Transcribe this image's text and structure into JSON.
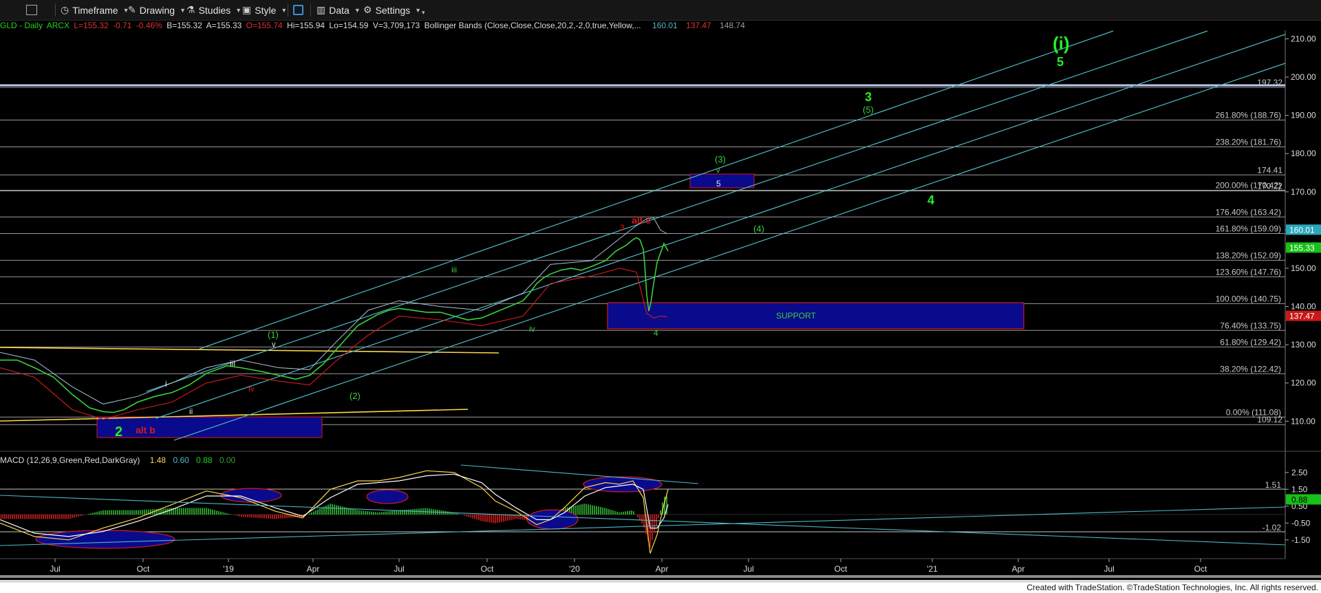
{
  "toolbar": {
    "timeframe": "Timeframe",
    "drawing": "Drawing",
    "studies": "Studies",
    "style": "Style",
    "data": "Data",
    "settings": "Settings"
  },
  "status": {
    "symbol": "GLD - Daily",
    "exchange": "ARCX",
    "last": "L=155.32",
    "change": "-0.71",
    "change_pct": "-0.46%",
    "bid": "B=155.32",
    "ask": "A=155.33",
    "open": "O=155.74",
    "high": "Hi=155.94",
    "low": "Lo=154.59",
    "volume": "V=3,709,173",
    "study": "Bollinger Bands (Close,Close,Close,20,2,-2,0,true,Yellow,...",
    "bb_upper": "160.01",
    "bb_lower": "137.47",
    "bb_mid": "148.74"
  },
  "macd_header": {
    "name": "MACD (12,26,9,Green,Red,DarkGray)",
    "v1": "1.48",
    "v2": "0.60",
    "v3": "0.88",
    "v4": "0.00"
  },
  "footer": "Created with TradeStation. ©TradeStation Technologies, Inc. All rights reserved.",
  "colors": {
    "green": "#3ad13a",
    "bright_green": "#22ee22",
    "red": "#d81b1b",
    "cyan": "#4fb8c9",
    "yellow": "#ffd84a",
    "blue_box": "#0a0a8c",
    "grid": "#9a9a9a"
  },
  "chart_data": [
    {
      "type": "line",
      "title": "GLD - Daily",
      "price_axis": {
        "ylim": [
          107,
          213
        ],
        "ticks": [
          110,
          120,
          130,
          140,
          150,
          160,
          170,
          180,
          190,
          200,
          210
        ]
      },
      "time_axis": {
        "labels": [
          "Jul",
          "Oct",
          "'19",
          "Apr",
          "Jul",
          "Oct",
          "'20",
          "Apr",
          "Jul",
          "Oct",
          "'21",
          "Apr",
          "Jul",
          "Oct"
        ]
      },
      "fib_levels": [
        {
          "label": "0.00% (111.08)",
          "value": 111.08
        },
        {
          "label": "38.20% (122.42)",
          "value": 122.42
        },
        {
          "label": "61.80% (129.42)",
          "value": 129.42
        },
        {
          "label": "76.40% (133.75)",
          "value": 133.75
        },
        {
          "label": "100.00% (140.75)",
          "value": 140.75
        },
        {
          "label": "123.60% (147.76)",
          "value": 147.76
        },
        {
          "label": "138.20% (152.09)",
          "value": 152.09
        },
        {
          "label": "161.80% (159.09)",
          "value": 159.09
        },
        {
          "label": "176.40% (163.42)",
          "value": 163.42
        },
        {
          "label": "200.00% (170.42)",
          "value": 170.42
        },
        {
          "label": "238.20% (181.76)",
          "value": 181.76
        },
        {
          "label": "261.80% (188.76)",
          "value": 188.76
        }
      ],
      "price_markers": [
        {
          "label": "197.32",
          "value": 197.32
        },
        {
          "label": "174.41",
          "value": 174.41
        },
        {
          "label": "170.22",
          "value": 170.22
        },
        {
          "label": "109.12",
          "value": 109.12
        }
      ],
      "axis_badges": [
        {
          "label": "160.01",
          "value": 160.01,
          "color": "#2aa6b8"
        },
        {
          "label": "155.33",
          "value": 155.33,
          "color": "#18c018"
        },
        {
          "label": "137.47",
          "value": 137.47,
          "color": "#c81818"
        }
      ],
      "boxes": [
        {
          "label": "SUPPORT",
          "x_start": "2020-02-10",
          "x_end": "2021-03-25",
          "y_low": 133.7,
          "y_high": 140.75
        },
        {
          "label": "5",
          "x_start": "2020-04-25",
          "x_end": "2020-06-10",
          "y_low": 170.6,
          "y_high": 174.3
        },
        {
          "label": "2",
          "x_start": "2018-08-01",
          "x_end": "2018-12-31",
          "y_low": 106.2,
          "y_high": 111.3
        }
      ],
      "wave_labels": [
        {
          "text": "(i)",
          "color": "bright_green"
        },
        {
          "text": "5",
          "color": "bright_green"
        },
        {
          "text": "3",
          "color": "bright_green"
        },
        {
          "text": "(5)",
          "color": "green"
        },
        {
          "text": "(3)",
          "color": "green"
        },
        {
          "text": "v",
          "color": "green"
        },
        {
          "text": "4",
          "color": "bright_green"
        },
        {
          "text": "(4)",
          "color": "green"
        },
        {
          "text": "alt c",
          "color": "red"
        },
        {
          "text": "3",
          "color": "red"
        },
        {
          "text": "iii",
          "color": "green"
        },
        {
          "text": "iv",
          "color": "green"
        },
        {
          "text": "4",
          "color": "green"
        },
        {
          "text": "(1)",
          "color": "green"
        },
        {
          "text": "v",
          "color": "white"
        },
        {
          "text": "iii",
          "color": "white"
        },
        {
          "text": "iv",
          "color": "red"
        },
        {
          "text": "i",
          "color": "white"
        },
        {
          "text": "ii",
          "color": "white"
        },
        {
          "text": "(2)",
          "color": "green"
        },
        {
          "text": "2",
          "color": "bright_green"
        },
        {
          "text": "alt b",
          "color": "red"
        }
      ],
      "series": [
        {
          "values": [
            [
              0,
              126
            ],
            [
              25,
              126
            ],
            [
              50,
              124
            ],
            [
              78,
              121.5
            ],
            [
              105,
              117
            ],
            [
              130,
              113.5
            ],
            [
              150,
              112.5
            ],
            [
              165,
              112.3
            ],
            [
              180,
              113
            ],
            [
              200,
              115
            ],
            [
              225,
              116.5
            ],
            [
              250,
              117.5
            ],
            [
              275,
              119.5
            ],
            [
              300,
              122.5
            ],
            [
              330,
              124.5
            ],
            [
              350,
              124
            ],
            [
              380,
              123
            ],
            [
              405,
              122
            ],
            [
              430,
              121
            ],
            [
              450,
              122
            ],
            [
              470,
              125
            ],
            [
              490,
              129
            ],
            [
              505,
              132
            ],
            [
              520,
              135
            ],
            [
              535,
              136.5
            ],
            [
              550,
              138
            ],
            [
              565,
              139
            ],
            [
              580,
              139.5
            ],
            [
              600,
              139
            ],
            [
              620,
              138.5
            ],
            [
              640,
              138.5
            ],
            [
              660,
              137.5
            ],
            [
              680,
              136.5
            ],
            [
              700,
              137
            ],
            [
              720,
              138.5
            ],
            [
              740,
              140
            ],
            [
              760,
              141.5
            ],
            [
              770,
              143.5
            ],
            [
              780,
              146
            ],
            [
              790,
              147.5
            ],
            [
              800,
              148.5
            ],
            [
              815,
              149.5
            ],
            [
              830,
              150
            ],
            [
              845,
              149.5
            ],
            [
              860,
              150.5
            ],
            [
              880,
              152
            ],
            [
              895,
              154.5
            ],
            [
              910,
              156
            ],
            [
              920,
              157.5
            ],
            [
              925,
              158
            ],
            [
              930,
              157.5
            ],
            [
              935,
              155
            ],
            [
              937,
              151
            ],
            [
              940,
              143
            ],
            [
              943,
              138.8
            ],
            [
              946,
              141
            ],
            [
              950,
              146
            ],
            [
              955,
              151.5
            ],
            [
              960,
              154
            ],
            [
              965,
              156.5
            ],
            [
              968,
              155.5
            ],
            [
              971,
              154.5
            ]
          ]
        },
        {
          "values": [
            [
              0,
              128
            ],
            [
              50,
              126
            ],
            [
              105,
              119
            ],
            [
              150,
              114.5
            ],
            [
              200,
              116.5
            ],
            [
              250,
              120
            ],
            [
              300,
              124
            ],
            [
              350,
              126
            ],
            [
              405,
              124
            ],
            [
              450,
              123.5
            ],
            [
              490,
              131
            ],
            [
              535,
              139
            ],
            [
              580,
              141.5
            ],
            [
              640,
              140
            ],
            [
              700,
              139
            ],
            [
              760,
              143.5
            ],
            [
              800,
              151
            ],
            [
              860,
              152
            ],
            [
              920,
              160.5
            ],
            [
              940,
              163
            ],
            [
              950,
              163.2
            ],
            [
              960,
              160
            ],
            [
              970,
              159
            ]
          ]
        },
        {
          "values": [
            [
              0,
              124
            ],
            [
              50,
              121.5
            ],
            [
              105,
              113
            ],
            [
              150,
              110.5
            ],
            [
              200,
              113
            ],
            [
              250,
              115
            ],
            [
              300,
              120
            ],
            [
              350,
              122
            ],
            [
              405,
              120.5
            ],
            [
              450,
              119.5
            ],
            [
              490,
              126
            ],
            [
              535,
              132.5
            ],
            [
              580,
              137.5
            ],
            [
              640,
              136.5
            ],
            [
              700,
              135
            ],
            [
              760,
              137.5
            ],
            [
              800,
              146
            ],
            [
              860,
              148
            ],
            [
              900,
              150
            ],
            [
              925,
              149
            ],
            [
              940,
              138.2
            ],
            [
              950,
              137
            ],
            [
              960,
              137.5
            ],
            [
              970,
              137.3
            ]
          ]
        }
      ]
    },
    {
      "type": "bar",
      "title": "MACD (12,26,9,Green,Red,DarkGray)",
      "ylim": [
        -2.4,
        3.1
      ],
      "ticks": [
        2.5,
        1.5,
        0.5,
        -0.5,
        -1.5
      ],
      "reference_lines": [
        {
          "label": "1.51",
          "value": 1.51
        },
        {
          "label": "-1.02",
          "value": -1.02
        }
      ],
      "axis_badge": {
        "label": "0.88",
        "value": 0.88
      },
      "series": [
        {
          "values": [
            [
              0,
              -0.5
            ],
            [
              50,
              -1.3
            ],
            [
              100,
              -1.5
            ],
            [
              150,
              -0.8
            ],
            [
              200,
              -0.2
            ],
            [
              250,
              0.6
            ],
            [
              300,
              1.4
            ],
            [
              350,
              1.0
            ],
            [
              400,
              0.2
            ],
            [
              440,
              -0.2
            ],
            [
              480,
              1.5
            ],
            [
              520,
              2.0
            ],
            [
              550,
              2.0
            ],
            [
              580,
              2.2
            ],
            [
              620,
              2.6
            ],
            [
              660,
              2.5
            ],
            [
              700,
              1.6
            ],
            [
              720,
              0.8
            ],
            [
              750,
              0.2
            ],
            [
              780,
              -0.6
            ],
            [
              800,
              -0.3
            ],
            [
              820,
              0.4
            ],
            [
              850,
              1.6
            ],
            [
              880,
              1.9
            ],
            [
              900,
              1.8
            ],
            [
              920,
              2.0
            ],
            [
              935,
              1.0
            ],
            [
              945,
              -2.3
            ],
            [
              955,
              -1.2
            ],
            [
              965,
              0.6
            ],
            [
              971,
              1.5
            ]
          ]
        },
        {
          "values": [
            [
              0,
              -0.3
            ],
            [
              50,
              -1.1
            ],
            [
              100,
              -1.3
            ],
            [
              150,
              -1.0
            ],
            [
              200,
              -0.4
            ],
            [
              250,
              0.3
            ],
            [
              300,
              1.1
            ],
            [
              350,
              1.1
            ],
            [
              400,
              0.4
            ],
            [
              440,
              -0.1
            ],
            [
              480,
              1.0
            ],
            [
              520,
              1.8
            ],
            [
              550,
              1.9
            ],
            [
              580,
              2.0
            ],
            [
              620,
              2.3
            ],
            [
              660,
              2.4
            ],
            [
              700,
              1.9
            ],
            [
              720,
              1.2
            ],
            [
              750,
              0.4
            ],
            [
              780,
              -0.3
            ],
            [
              800,
              -0.3
            ],
            [
              820,
              0.1
            ],
            [
              850,
              1.1
            ],
            [
              880,
              1.6
            ],
            [
              900,
              1.7
            ],
            [
              920,
              1.8
            ],
            [
              935,
              1.5
            ],
            [
              945,
              -0.8
            ],
            [
              955,
              -0.8
            ],
            [
              965,
              -0.2
            ],
            [
              971,
              0.6
            ]
          ]
        }
      ]
    }
  ]
}
